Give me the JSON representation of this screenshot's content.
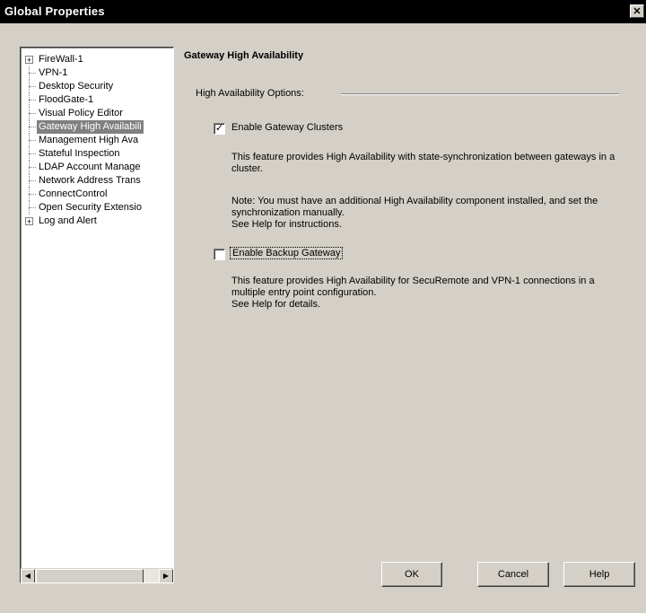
{
  "window": {
    "title": "Global Properties",
    "close_glyph": "✕"
  },
  "tree": {
    "items": [
      {
        "label": "FireWall-1",
        "expander": "+",
        "selected": false
      },
      {
        "label": "VPN-1",
        "expander": "",
        "selected": false
      },
      {
        "label": "Desktop Security",
        "expander": "",
        "selected": false
      },
      {
        "label": "FloodGate-1",
        "expander": "",
        "selected": false
      },
      {
        "label": "Visual Policy Editor",
        "expander": "",
        "selected": false
      },
      {
        "label": "Gateway High Availabili",
        "expander": "",
        "selected": true
      },
      {
        "label": "Management High Ava",
        "expander": "",
        "selected": false
      },
      {
        "label": "Stateful Inspection",
        "expander": "",
        "selected": false
      },
      {
        "label": "LDAP Account Manage",
        "expander": "",
        "selected": false
      },
      {
        "label": "Network Address Trans",
        "expander": "",
        "selected": false
      },
      {
        "label": "ConnectControl",
        "expander": "",
        "selected": false
      },
      {
        "label": "Open Security Extensio",
        "expander": "",
        "selected": false
      },
      {
        "label": "Log and Alert",
        "expander": "+",
        "selected": false
      }
    ],
    "scroll_left_glyph": "◀",
    "scroll_right_glyph": "▶"
  },
  "content": {
    "title": "Gateway High Availability",
    "group_label": "High Availability Options:",
    "clusters": {
      "checked": true,
      "check_glyph": "✓",
      "label": "Enable Gateway Clusters",
      "desc1": "This feature provides High Availability with state-synchronization between gateways in a cluster.",
      "desc2": "Note: You must have an additional High Availability component installed, and set the synchronization manually.",
      "desc3": "See Help for instructions."
    },
    "backup": {
      "checked": false,
      "label": "Enable Backup Gateway",
      "desc1": "This feature provides High Availability for SecuRemote and VPN-1 connections in a multiple entry point configuration.",
      "desc2": "See Help for details."
    }
  },
  "buttons": {
    "ok": "OK",
    "cancel": "Cancel",
    "help": "Help"
  }
}
